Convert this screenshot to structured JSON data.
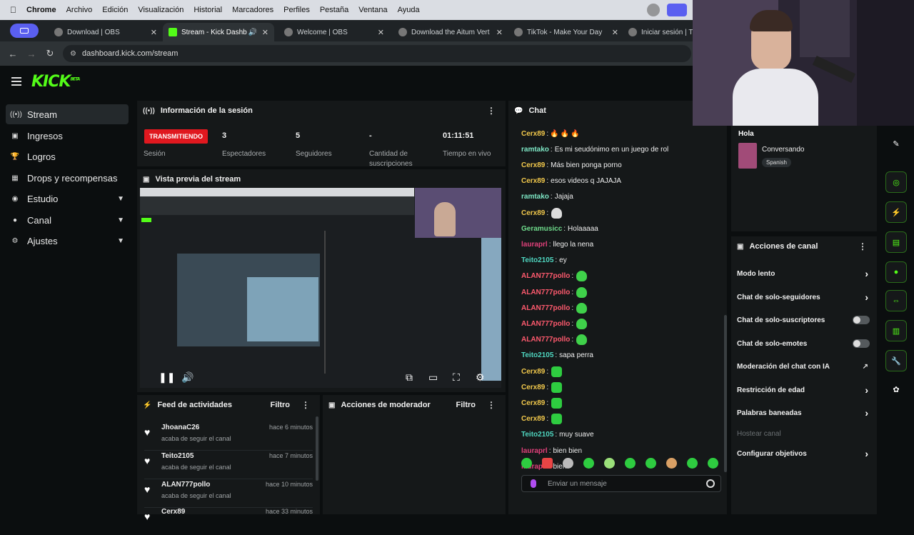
{
  "menubar": {
    "app": "Chrome",
    "items": [
      "Archivo",
      "Edición",
      "Visualización",
      "Historial",
      "Marcadores",
      "Perfiles",
      "Pestaña",
      "Ventana",
      "Ayuda"
    ]
  },
  "tabs": [
    {
      "label": "Download | OBS",
      "icon": "obs-icon",
      "active": false
    },
    {
      "label": "Stream - Kick Dashboard",
      "icon": "kick-icon",
      "active": true
    },
    {
      "label": "Welcome | OBS",
      "icon": "obs-icon",
      "active": false
    },
    {
      "label": "Download the Aitum Vertical",
      "icon": "aitum-icon",
      "active": false
    },
    {
      "label": "TikTok - Make Your Day",
      "icon": "tiktok-icon",
      "active": false
    },
    {
      "label": "Iniciar sesión | TikTok",
      "icon": "tiktok-icon",
      "active": false
    }
  ],
  "address": {
    "url": "dashboard.kick.com/stream"
  },
  "brand": {
    "logo": "KICK",
    "beta": "BETA",
    "accent": "#53fc18"
  },
  "sidebar": {
    "items": [
      {
        "label": "Stream",
        "icon": "broadcast-icon",
        "active": true,
        "expandable": false
      },
      {
        "label": "Ingresos",
        "icon": "wallet-icon",
        "active": false,
        "expandable": false
      },
      {
        "label": "Logros",
        "icon": "trophy-icon",
        "active": false,
        "expandable": false
      },
      {
        "label": "Drops y recompensas",
        "icon": "gift-icon",
        "active": false,
        "expandable": false
      },
      {
        "label": "Estudio",
        "icon": "studio-icon",
        "active": false,
        "expandable": true
      },
      {
        "label": "Canal",
        "icon": "user-icon",
        "active": false,
        "expandable": true
      },
      {
        "label": "Ajustes",
        "icon": "gear-icon",
        "active": false,
        "expandable": true
      }
    ]
  },
  "session": {
    "title": "Información de la sesión",
    "status": "TRANSMITIENDO",
    "status_label": "Sesión",
    "viewers": "3",
    "viewers_label": "Espectadores",
    "followers": "5",
    "followers_label": "Seguidores",
    "subs": "-",
    "subs_label": "Cantidad de suscripciones",
    "uptime": "01:11:51",
    "uptime_label": "Tiempo en vivo"
  },
  "preview": {
    "title": "Vista previa del stream"
  },
  "feed": {
    "title": "Feed de actividades",
    "filter": "Filtro",
    "rows": [
      {
        "user": "JhoanaC26",
        "action": "acaba de seguir el canal",
        "time": "hace 6 minutos"
      },
      {
        "user": "Teito2105",
        "action": "acaba de seguir el canal",
        "time": "hace 7 minutos"
      },
      {
        "user": "ALAN777pollo",
        "action": "acaba de seguir el canal",
        "time": "hace 10 minutos"
      },
      {
        "user": "Cerx89",
        "action": "",
        "time": "hace 33 minutos"
      }
    ]
  },
  "moderator": {
    "title": "Acciones de moderador",
    "filter": "Filtro"
  },
  "chat": {
    "title": "Chat",
    "messages": [
      {
        "user": "Cerx89",
        "color": "#f2c94c",
        "text": "",
        "emotes": "fire3"
      },
      {
        "user": "ramtako",
        "color": "#7ee8c6",
        "text": "Es mi seudónimo en un juego de rol",
        "emotes": ""
      },
      {
        "user": "Cerx89",
        "color": "#f2c94c",
        "text": "Más bien ponga porno",
        "emotes": ""
      },
      {
        "user": "Cerx89",
        "color": "#f2c94c",
        "text": "esos videos q JAJAJA",
        "emotes": ""
      },
      {
        "user": "ramtako",
        "color": "#7ee8c6",
        "text": "Jajaja",
        "emotes": ""
      },
      {
        "user": "Cerx89",
        "color": "#f2c94c",
        "text": "",
        "emotes": "ghost"
      },
      {
        "user": "Geramusicc",
        "color": "#6fdc8c",
        "text": "Holaaaaa",
        "emotes": ""
      },
      {
        "user": "lauraprl",
        "color": "#e0407a",
        "text": "llego la nena",
        "emotes": ""
      },
      {
        "user": "Teito2105",
        "color": "#4fd6c0",
        "text": "ey",
        "emotes": ""
      },
      {
        "user": "ALAN777pollo",
        "color": "#ff5a6e",
        "text": "",
        "emotes": "blob"
      },
      {
        "user": "ALAN777pollo",
        "color": "#ff5a6e",
        "text": "",
        "emotes": "blob"
      },
      {
        "user": "ALAN777pollo",
        "color": "#ff5a6e",
        "text": "",
        "emotes": "blob"
      },
      {
        "user": "ALAN777pollo",
        "color": "#ff5a6e",
        "text": "",
        "emotes": "blob"
      },
      {
        "user": "ALAN777pollo",
        "color": "#ff5a6e",
        "text": "",
        "emotes": "blob"
      },
      {
        "user": "Teito2105",
        "color": "#4fd6c0",
        "text": "sapa perra",
        "emotes": ""
      },
      {
        "user": "Cerx89",
        "color": "#f2c94c",
        "text": "",
        "emotes": "square"
      },
      {
        "user": "Cerx89",
        "color": "#f2c94c",
        "text": "",
        "emotes": "square"
      },
      {
        "user": "Cerx89",
        "color": "#f2c94c",
        "text": "",
        "emotes": "square"
      },
      {
        "user": "Cerx89",
        "color": "#f2c94c",
        "text": "",
        "emotes": "square"
      },
      {
        "user": "Teito2105",
        "color": "#4fd6c0",
        "text": "muy suave",
        "emotes": ""
      },
      {
        "user": "lauraprl",
        "color": "#e0407a",
        "text": "bien bien",
        "emotes": ""
      },
      {
        "user": "lauraprl",
        "color": "#e0407a",
        "text": "bien",
        "emotes": ""
      }
    ],
    "input_placeholder": "Enviar un mensaje"
  },
  "stream_info": {
    "title": "Hola",
    "category": "Conversando",
    "language": "Spanish"
  },
  "channel_actions": {
    "title": "Acciones de canal",
    "items": [
      {
        "label": "Modo lento",
        "kind": "chevron"
      },
      {
        "label": "Chat de solo-seguidores",
        "kind": "chevron"
      },
      {
        "label": "Chat de solo-suscriptores",
        "kind": "toggle"
      },
      {
        "label": "Chat de solo-emotes",
        "kind": "toggle"
      },
      {
        "label": "Moderación del chat con IA",
        "kind": "external"
      },
      {
        "label": "Restricción de edad",
        "kind": "chevron"
      },
      {
        "label": "Palabras baneadas",
        "kind": "chevron"
      },
      {
        "label": "Hostear canal",
        "kind": "disabled"
      },
      {
        "label": "Configurar objetivos",
        "kind": "chevron"
      }
    ]
  },
  "rail": {
    "icons": [
      "pencil-icon",
      "record-icon",
      "lightning-icon",
      "document-icon",
      "chat-bubble-icon",
      "link-icon",
      "layout-icon",
      "wrench-icon",
      "palette-icon"
    ]
  }
}
